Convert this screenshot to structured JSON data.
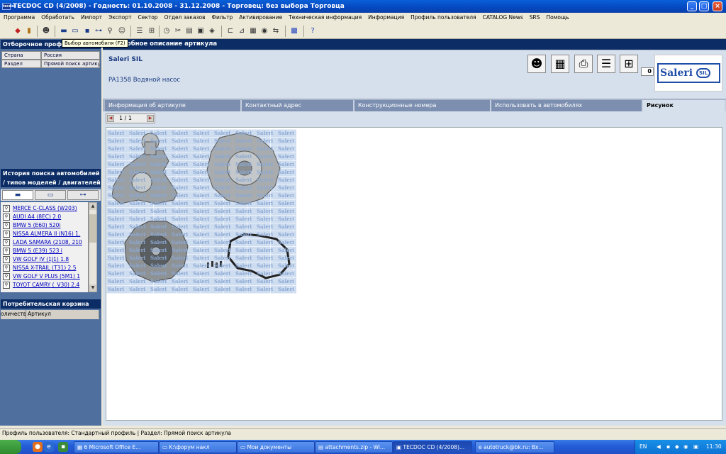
{
  "window": {
    "title": "TECDOC CD (4/2008)  - Годность: 01.10.2008 - 31.12.2008  - Торговец: без выбора Торговца",
    "app_icon": "tecdoc",
    "controls": [
      "minimize",
      "maximize",
      "close"
    ]
  },
  "menu": [
    "Программа",
    "Обработать",
    "Импорт",
    "Экспорт",
    "Сектор",
    "Отдел заказов",
    "Фильтр",
    "Активирование",
    "Техническая информация",
    "Информация",
    "Профиль пользователя",
    "CATALOG News",
    "SRS",
    "Помощь"
  ],
  "toolbar": {
    "icons": [
      "back-icon",
      "forward-icon",
      "person-icon",
      "car-icon",
      "commercial-vehicle-icon",
      "engine-icon",
      "axle-icon",
      "search-icon",
      "search-person-icon",
      "list-icon",
      "basket-icon",
      "clock-icon",
      "tools-icon",
      "document-icon",
      "image-icon",
      "layers-icon",
      "hierarchy-icon",
      "graph-icon",
      "table-icon",
      "globe-icon",
      "swap-icon",
      "calendar-icon",
      "help-icon"
    ],
    "tooltip": "Выбор автомобиля (F2)"
  },
  "left": {
    "header1": "Отборочное профи",
    "criteria": [
      {
        "label": "Страна",
        "value": "Россия"
      },
      {
        "label": "Раздел",
        "value": "Прямой поиск артикулу"
      }
    ],
    "history_title_1": "История поиска автомобилей",
    "history_title_2": "/ типов моделей / двигателей",
    "history_tabs": [
      "car-icon",
      "truck-icon",
      "axle-icon"
    ],
    "history": [
      "MERCE C-CLASS (W203)",
      "AUDI A4 (8EC) 2.0",
      "BMW 5 (E60) 520i",
      "NISSA ALMERA II (N16) 1.",
      "LADA SAMARA (2108, 210",
      "BMW 5 (E39) 523 i",
      "VW GOLF IV (1J1) 1.8",
      "NISSA X-TRAIL (T31) 2.5",
      "VW GOLF V PLUS (5M1) 1",
      "TOYOT CAMRY (_V30) 2.4"
    ],
    "basket_title": "Потребительская корзина",
    "basket_columns": [
      "оличеств",
      "Артикул"
    ]
  },
  "right": {
    "header": "Подробное описание артикула",
    "supplier": "Saleri SIL",
    "article": "PA1358 Водяной насос",
    "counter": "0",
    "action_icons": [
      "info-person-icon",
      "parts-list-icon",
      "print-icon",
      "document-list-icon",
      "add-basket-icon"
    ],
    "logo_text": "Saleri",
    "logo_badge": "SIL",
    "tabs": [
      {
        "label": "Информация об артикуле",
        "active": false
      },
      {
        "label": "Контактный адрес",
        "active": false
      },
      {
        "label": "Конструкционные номера",
        "active": false
      },
      {
        "label": "Использовать в автомобилях",
        "active": false
      },
      {
        "label": "Рисунок",
        "active": true
      }
    ],
    "pager": {
      "current": "1",
      "sep": "/",
      "total": "1"
    },
    "image_watermark": "Saleri"
  },
  "status": "Профиль пользователя: Стандартный профиль | Раздел: Прямой поиск артикула",
  "taskbar": {
    "quicklaunch": [
      "firefox-icon",
      "ie-icon",
      "desktop-icon"
    ],
    "tasks": [
      {
        "label": "6 Microsoft Office E...",
        "icon": "office-icon",
        "active": false
      },
      {
        "label": "K:\\форум накл",
        "icon": "folder-icon",
        "active": false
      },
      {
        "label": "Мои документы",
        "icon": "folder-icon",
        "active": false
      },
      {
        "label": "attachments.zip - Wi...",
        "icon": "zip-icon",
        "active": false
      },
      {
        "label": "TECDOC CD (4/2008)...",
        "icon": "tecdoc-icon",
        "active": true
      },
      {
        "label": "autotruck@bk.ru: Вх...",
        "icon": "ie-icon",
        "active": false
      }
    ],
    "lang": "EN",
    "clock": "11:30"
  }
}
